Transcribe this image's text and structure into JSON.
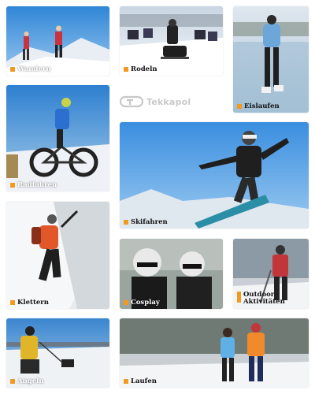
{
  "brand": {
    "name": "Tekkapol",
    "logo_icon": "tekkapol-logo-icon",
    "color": "#c8c8c8"
  },
  "accent_color": "#f29a1f",
  "tiles": [
    {
      "label": "Wandern",
      "icon": "label-square-icon"
    },
    {
      "label": "Rodeln",
      "icon": "label-square-icon"
    },
    {
      "label": "Eislaufen",
      "icon": "label-square-icon"
    },
    {
      "label": "Radfahren",
      "icon": "label-square-icon"
    },
    {
      "label": "Skifahren",
      "icon": "label-square-icon"
    },
    {
      "label": "Klettern",
      "icon": "label-square-icon"
    },
    {
      "label": "Cosplay",
      "icon": "label-square-icon"
    },
    {
      "label": "Outdoor-\nAktivitäten",
      "icon": "label-square-icon"
    },
    {
      "label": "Angeln",
      "icon": "label-square-icon"
    },
    {
      "label": "Laufen",
      "icon": "label-square-icon"
    }
  ]
}
